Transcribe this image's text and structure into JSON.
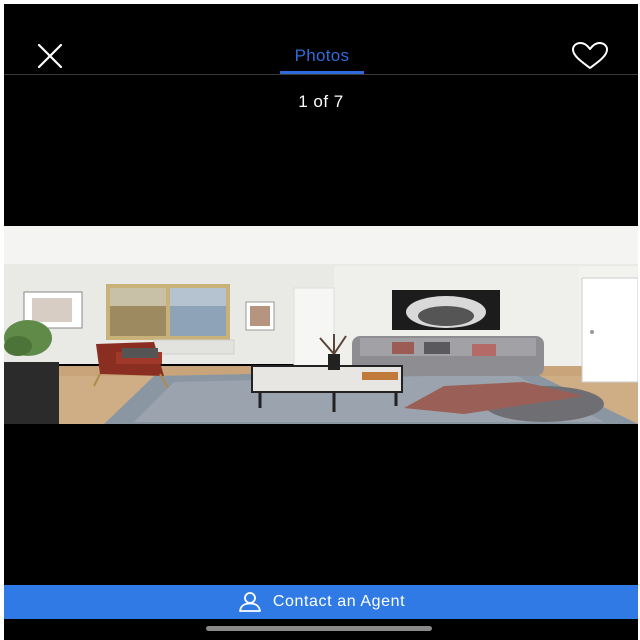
{
  "header": {
    "tab_label": "Photos",
    "counter": "1 of 7"
  },
  "icons": {
    "close": "close-icon",
    "favorite": "heart-icon",
    "contact": "person-icon"
  },
  "photo": {
    "description": "Living room listing photo"
  },
  "contact": {
    "label": "Contact an Agent"
  },
  "colors": {
    "accent": "#2f6bdc",
    "contact_bar": "#2f7ae5",
    "background": "#000000"
  }
}
